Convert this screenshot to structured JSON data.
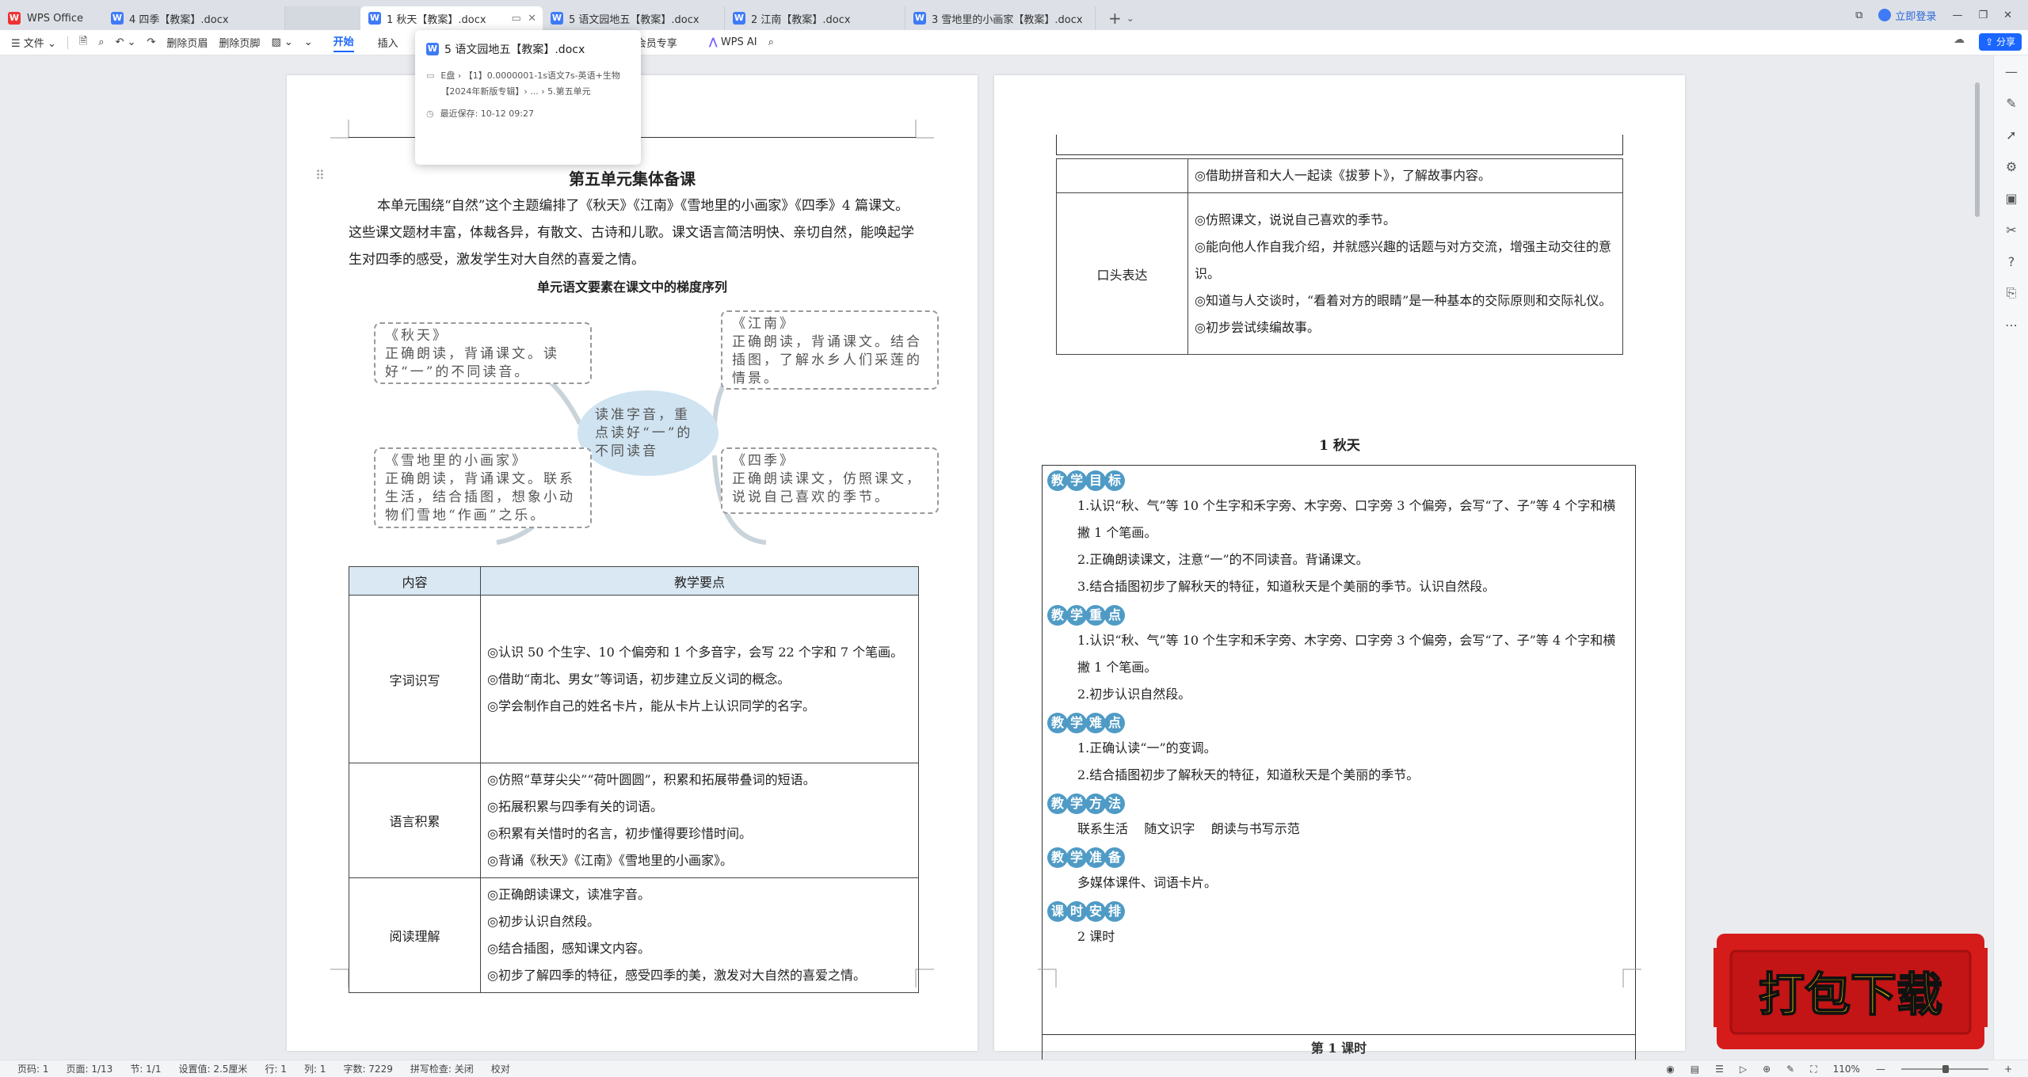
{
  "app": {
    "name": "WPS Office"
  },
  "tabs": [
    {
      "label": "4 四季【教案】.docx"
    },
    {
      "label": ""
    },
    {
      "label": "1 秋天【教案】.docx"
    },
    {
      "label": "5 语文园地五【教案】.docx"
    },
    {
      "label": "2 江南【教案】.docx"
    },
    {
      "label": "3 雪地里的小画家【教案】.docx"
    }
  ],
  "tabbar_right": {
    "login": "立即登录"
  },
  "toolbar": {
    "file": "文件",
    "delete_header": "删除页眉",
    "delete_footer": "删除页脚",
    "start": "开始",
    "insert": "插入",
    "member": "会员专享",
    "wps_ai": "WPS AI",
    "share": "分享"
  },
  "popup": {
    "title": "5 语文园地五【教案】.docx",
    "path": "E盘 › 【1】0.0000001-1s语文7s-英语+生物【2024年新版专辑】› ... › 5.第五单元",
    "saved": "最近保存: 10-12 09:27"
  },
  "page1": {
    "title": "第五单元集体备课",
    "intro": "本单元围绕“自然”这个主题编排了《秋天》《江南》《雪地里的小画家》《四季》4 篇课文。这些课文题材丰富，体裁各异，有散文、古诗和儿歌。课文语言简洁明快、亲切自然，能唤起学生对四季的感受，激发学生对大自然的喜爱之情。",
    "subtitle": "单元语文要素在课文中的梯度序列",
    "mindmap": {
      "center": "读准字音，重点读好“一”的不同读音",
      "autumn": {
        "title": "《秋天》",
        "text": "正确朗读，背诵课文。读好“一”的不同读音。"
      },
      "jiangnan": {
        "title": "《江南》",
        "text": "正确朗读，背诵课文。结合插图，了解水乡人们采莲的情景。"
      },
      "snow": {
        "title": "《雪地里的小画家》",
        "text": "正确朗读，背诵课文。联系生活，结合插图，想象小动物们雪地“作画”之乐。"
      },
      "seasons": {
        "title": "《四季》",
        "text": "正确朗读课文，仿照课文，说说自己喜欢的季节。"
      }
    },
    "table": {
      "headers": [
        "内容",
        "教学要点"
      ],
      "rows": [
        {
          "label": "字词识写",
          "points": [
            "◎认识 50 个生字、10 个偏旁和 1 个多音字，会写 22 个字和 7 个笔画。",
            "◎借助“南北、男女”等词语，初步建立反义词的概念。",
            "◎学会制作自己的姓名卡片，能从卡片上认识同学的名字。"
          ]
        },
        {
          "label": "语言积累",
          "points": [
            "◎仿照“草芽尖尖”“荷叶圆圆”，积累和拓展带叠词的短语。",
            "◎拓展积累与四季有关的词语。",
            "◎积累有关惜时的名言，初步懂得要珍惜时间。",
            "◎背诵《秋天》《江南》《雪地里的小画家》。"
          ]
        },
        {
          "label": "阅读理解",
          "points": [
            "◎正确朗读课文，读准字音。",
            "◎初步认识自然段。",
            "◎结合插图，感知课文内容。",
            "◎初步了解四季的特征，感受四季的美，激发对大自然的喜爱之情。"
          ]
        }
      ]
    }
  },
  "page2": {
    "table": {
      "top_row": "◎借助拼音和大人一起读《拔萝卜》，了解故事内容。",
      "oral_label": "口头表达",
      "oral_points": [
        "◎仿照课文，说说自己喜欢的季节。",
        "◎能向他人作自我介绍，并就感兴趣的话题与对方交流，增强主动交往的意识。",
        "◎知道与人交谈时，“看着对方的眼睛”是一种基本的交际原则和交际礼仪。",
        "◎初步尝试续编故事。"
      ]
    },
    "lesson_title": "1  秋天",
    "sections": [
      {
        "head": [
          "教",
          "学",
          "目",
          "标"
        ],
        "lines": [
          "1.认识“秋、气”等 10 个生字和禾字旁、木字旁、口字旁 3 个偏旁，会写“了、子”等 4 个字和横撇 1 个笔画。",
          "2.正确朗读课文，注意“一”的不同读音。背诵课文。",
          "3.结合插图初步了解秋天的特征，知道秋天是个美丽的季节。认识自然段。"
        ]
      },
      {
        "head": [
          "教",
          "学",
          "重",
          "点"
        ],
        "lines": [
          "1.认识“秋、气”等 10 个生字和禾字旁、木字旁、口字旁 3 个偏旁，会写“了、子”等 4 个字和横撇 1 个笔画。",
          "2.初步认识自然段。"
        ]
      },
      {
        "head": [
          "教",
          "学",
          "难",
          "点"
        ],
        "lines": [
          "1.正确认读“一”的变调。",
          "2.结合插图初步了解秋天的特征，知道秋天是个美丽的季节。"
        ]
      },
      {
        "head": [
          "教",
          "学",
          "方",
          "法"
        ],
        "lines": [
          "联系生活    随文识字    朗读与书写示范"
        ]
      },
      {
        "head": [
          "教",
          "学",
          "准",
          "备"
        ],
        "lines": [
          "多媒体课件、词语卡片。"
        ]
      },
      {
        "head": [
          "课",
          "时",
          "安",
          "排"
        ],
        "lines": [
          "2 课时"
        ]
      }
    ],
    "lesson_period": "第 1 课时"
  },
  "status": {
    "page_code": "页码: 1",
    "page": "页面: 1/13",
    "section": "节: 1/1",
    "setting": "设置值: 2.5厘米",
    "row": "行: 1",
    "col": "列: 1",
    "word_count": "字数: 7229",
    "spell": "拼写检查: 关闭",
    "proof": "校对",
    "zoom": "110%"
  },
  "download_banner": {
    "text": "打包下载"
  },
  "colors": {
    "accent": "#1a66ff",
    "section_badge": "#4f9bc6",
    "table_header": "#dae8f3",
    "banner": "#d61b1b"
  }
}
